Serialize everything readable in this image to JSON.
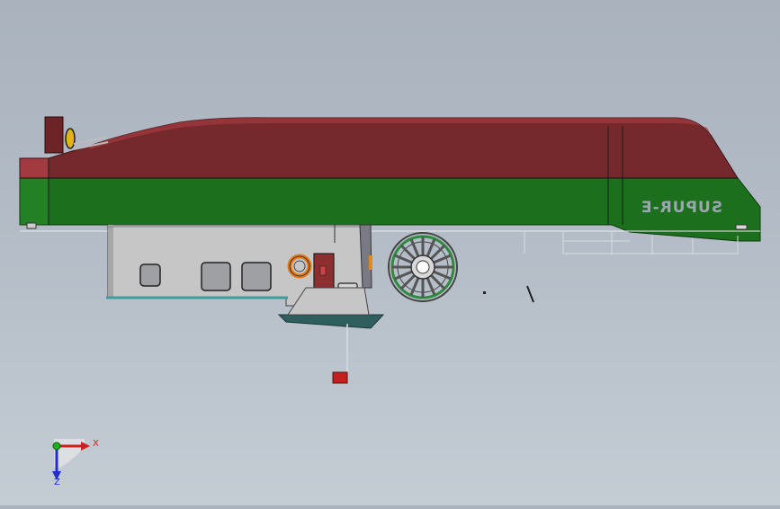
{
  "hull": {
    "name_text": "SUPUR-E",
    "colors": {
      "upper": "#76292d",
      "lower": "#1c6f1c",
      "superstructure": "#c4c4c4",
      "outline": "#2b2b2b"
    }
  },
  "triad": {
    "x_label": "X",
    "z_label": "Z",
    "colors": {
      "x": "#d02020",
      "y": "#20b020",
      "z": "#2030c8"
    }
  }
}
